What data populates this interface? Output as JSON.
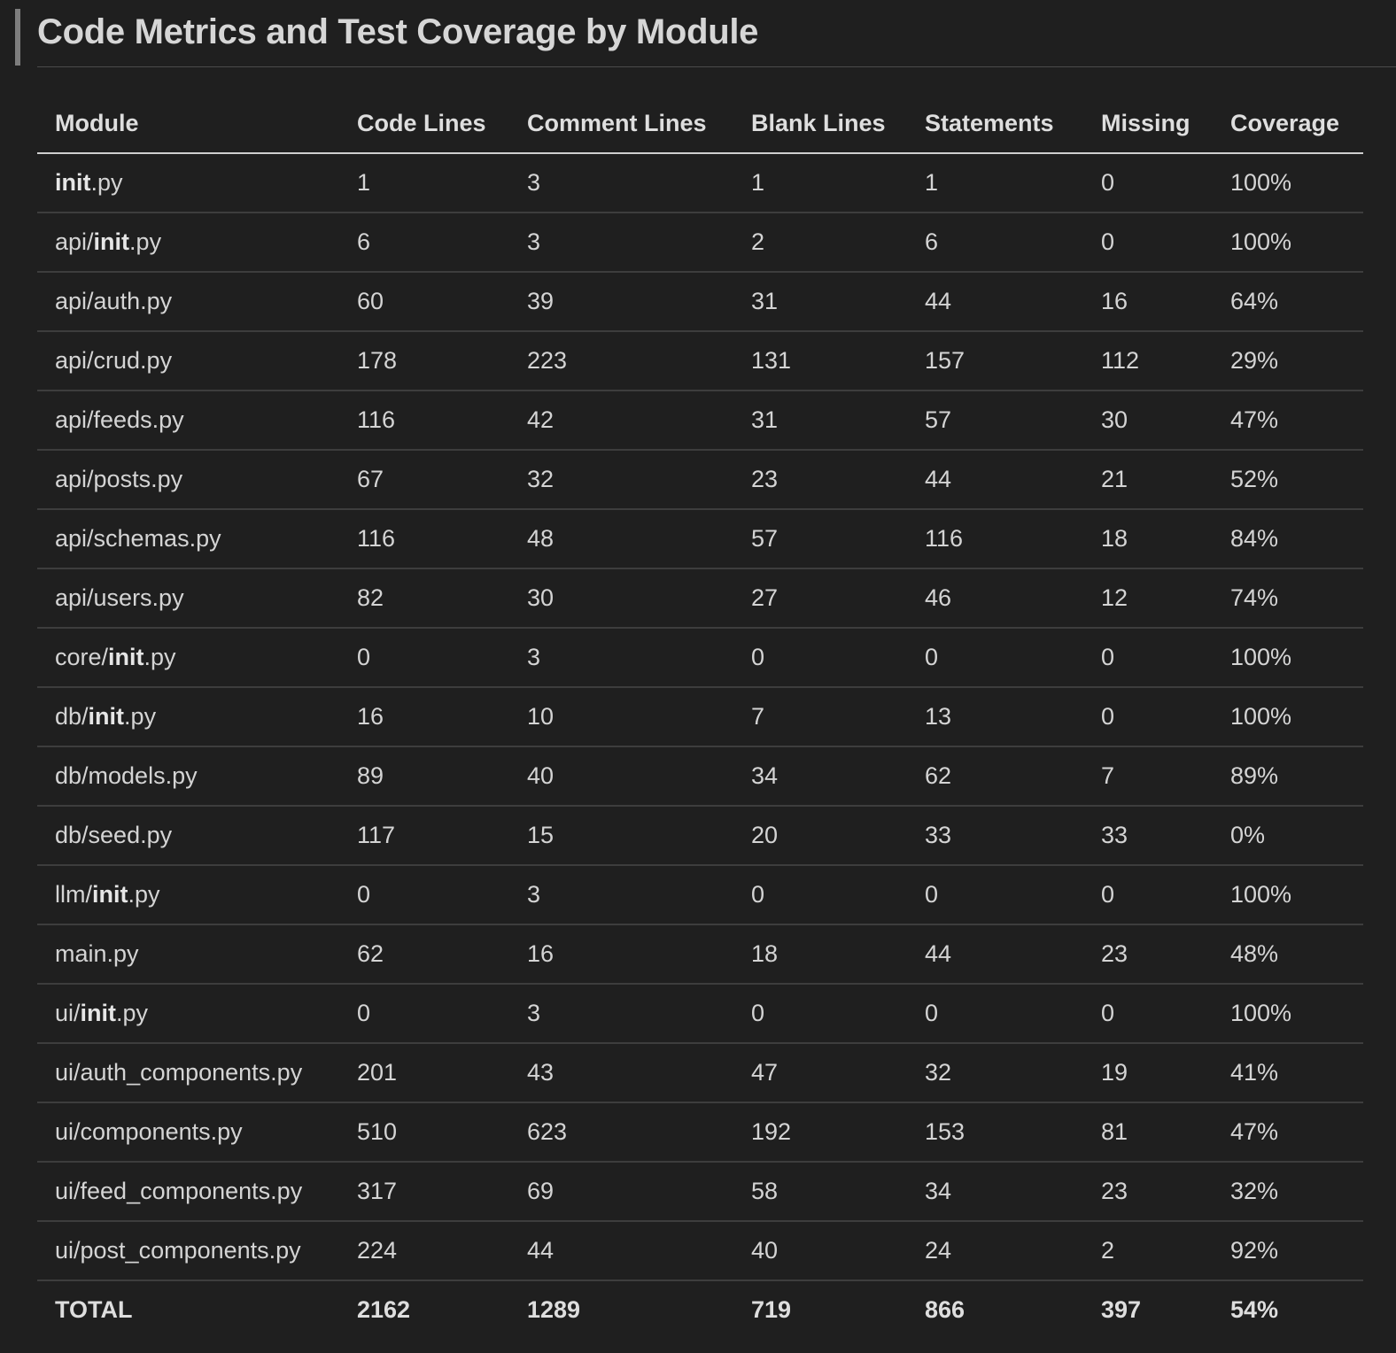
{
  "title": "Code Metrics and Test Coverage by Module",
  "columns": [
    "Module",
    "Code Lines",
    "Comment Lines",
    "Blank Lines",
    "Statements",
    "Missing",
    "Coverage"
  ],
  "rows": [
    {
      "module": {
        "pre": "",
        "bold": "init",
        "post": ".py"
      },
      "code": "1",
      "comment": "3",
      "blank": "1",
      "statements": "1",
      "missing": "0",
      "coverage": "100%"
    },
    {
      "module": {
        "pre": "api/",
        "bold": "init",
        "post": ".py"
      },
      "code": "6",
      "comment": "3",
      "blank": "2",
      "statements": "6",
      "missing": "0",
      "coverage": "100%"
    },
    {
      "module": {
        "pre": "api/auth.py",
        "bold": "",
        "post": ""
      },
      "code": "60",
      "comment": "39",
      "blank": "31",
      "statements": "44",
      "missing": "16",
      "coverage": "64%"
    },
    {
      "module": {
        "pre": "api/crud.py",
        "bold": "",
        "post": ""
      },
      "code": "178",
      "comment": "223",
      "blank": "131",
      "statements": "157",
      "missing": "112",
      "coverage": "29%"
    },
    {
      "module": {
        "pre": "api/feeds.py",
        "bold": "",
        "post": ""
      },
      "code": "116",
      "comment": "42",
      "blank": "31",
      "statements": "57",
      "missing": "30",
      "coverage": "47%"
    },
    {
      "module": {
        "pre": "api/posts.py",
        "bold": "",
        "post": ""
      },
      "code": "67",
      "comment": "32",
      "blank": "23",
      "statements": "44",
      "missing": "21",
      "coverage": "52%"
    },
    {
      "module": {
        "pre": "api/schemas.py",
        "bold": "",
        "post": ""
      },
      "code": "116",
      "comment": "48",
      "blank": "57",
      "statements": "116",
      "missing": "18",
      "coverage": "84%"
    },
    {
      "module": {
        "pre": "api/users.py",
        "bold": "",
        "post": ""
      },
      "code": "82",
      "comment": "30",
      "blank": "27",
      "statements": "46",
      "missing": "12",
      "coverage": "74%"
    },
    {
      "module": {
        "pre": "core/",
        "bold": "init",
        "post": ".py"
      },
      "code": "0",
      "comment": "3",
      "blank": "0",
      "statements": "0",
      "missing": "0",
      "coverage": "100%"
    },
    {
      "module": {
        "pre": "db/",
        "bold": "init",
        "post": ".py"
      },
      "code": "16",
      "comment": "10",
      "blank": "7",
      "statements": "13",
      "missing": "0",
      "coverage": "100%"
    },
    {
      "module": {
        "pre": "db/models.py",
        "bold": "",
        "post": ""
      },
      "code": "89",
      "comment": "40",
      "blank": "34",
      "statements": "62",
      "missing": "7",
      "coverage": "89%"
    },
    {
      "module": {
        "pre": "db/seed.py",
        "bold": "",
        "post": ""
      },
      "code": "117",
      "comment": "15",
      "blank": "20",
      "statements": "33",
      "missing": "33",
      "coverage": "0%"
    },
    {
      "module": {
        "pre": "llm/",
        "bold": "init",
        "post": ".py"
      },
      "code": "0",
      "comment": "3",
      "blank": "0",
      "statements": "0",
      "missing": "0",
      "coverage": "100%"
    },
    {
      "module": {
        "pre": "main.py",
        "bold": "",
        "post": ""
      },
      "code": "62",
      "comment": "16",
      "blank": "18",
      "statements": "44",
      "missing": "23",
      "coverage": "48%"
    },
    {
      "module": {
        "pre": "ui/",
        "bold": "init",
        "post": ".py"
      },
      "code": "0",
      "comment": "3",
      "blank": "0",
      "statements": "0",
      "missing": "0",
      "coverage": "100%"
    },
    {
      "module": {
        "pre": "ui/auth_components.py",
        "bold": "",
        "post": ""
      },
      "code": "201",
      "comment": "43",
      "blank": "47",
      "statements": "32",
      "missing": "19",
      "coverage": "41%"
    },
    {
      "module": {
        "pre": "ui/components.py",
        "bold": "",
        "post": ""
      },
      "code": "510",
      "comment": "623",
      "blank": "192",
      "statements": "153",
      "missing": "81",
      "coverage": "47%"
    },
    {
      "module": {
        "pre": "ui/feed_components.py",
        "bold": "",
        "post": ""
      },
      "code": "317",
      "comment": "69",
      "blank": "58",
      "statements": "34",
      "missing": "23",
      "coverage": "32%"
    },
    {
      "module": {
        "pre": "ui/post_components.py",
        "bold": "",
        "post": ""
      },
      "code": "224",
      "comment": "44",
      "blank": "40",
      "statements": "24",
      "missing": "2",
      "coverage": "92%"
    }
  ],
  "total": {
    "label": "TOTAL",
    "code": "2162",
    "comment": "1289",
    "blank": "719",
    "statements": "866",
    "missing": "397",
    "coverage": "54%"
  }
}
